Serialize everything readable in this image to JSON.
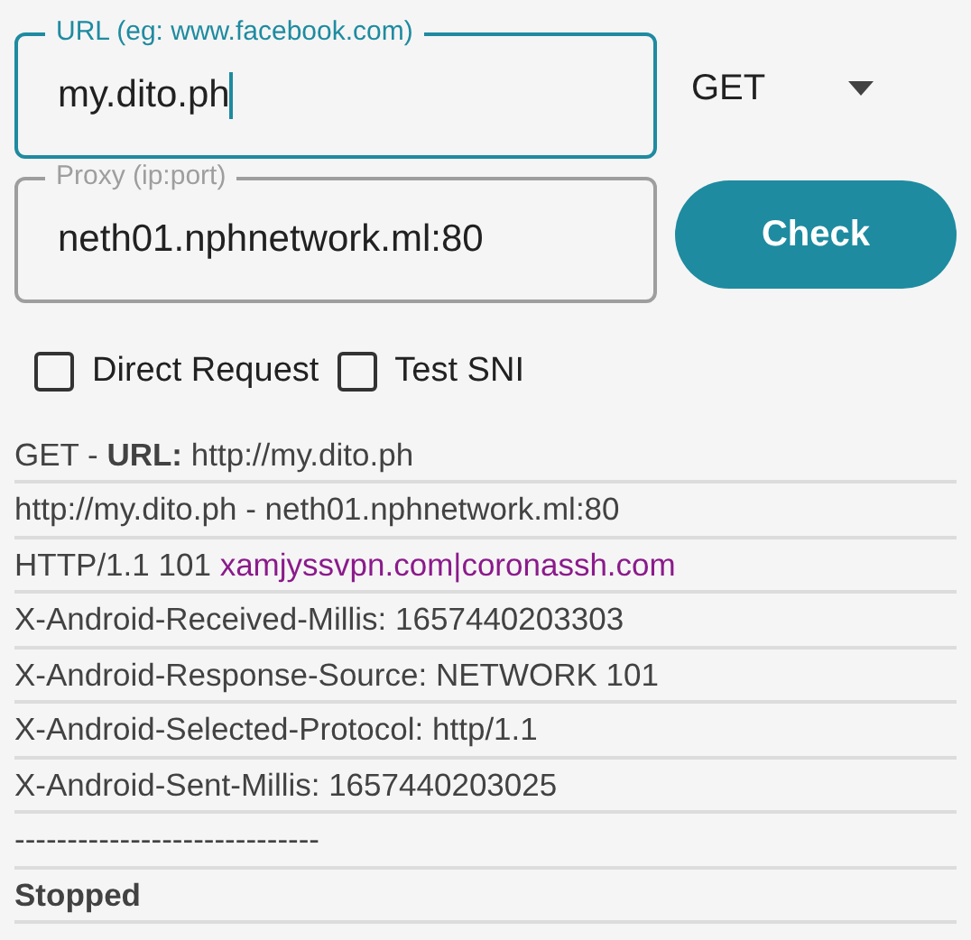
{
  "url_field": {
    "label": "URL (eg: www.facebook.com)",
    "value": "my.dito.ph",
    "focused": true
  },
  "method_dropdown": {
    "value": "GET"
  },
  "proxy_field": {
    "label": "Proxy (ip:port)",
    "value": "neth01.nphnetwork.ml:80",
    "focused": false
  },
  "check_button": {
    "label": "Check"
  },
  "options": [
    {
      "label": "Direct Request",
      "checked": false
    },
    {
      "label": "Test SNI",
      "checked": false
    }
  ],
  "log": [
    {
      "kind": "plain",
      "text": "GET - **URL:** http://my.dito.ph"
    },
    {
      "kind": "plain",
      "text": "http://my.dito.ph - neth01.nphnetwork.ml:80"
    },
    {
      "kind": "highlight",
      "text": "HTTP/1.1 101",
      "highlight": "xamjyssvpn.com|coronassh.com"
    },
    {
      "kind": "plain",
      "text": "X-Android-Received-Millis: 1657440203303"
    },
    {
      "kind": "plain",
      "text": "X-Android-Response-Source: NETWORK 101"
    },
    {
      "kind": "plain",
      "text": "X-Android-Selected-Protocol: http/1.1"
    },
    {
      "kind": "plain",
      "text": "X-Android-Sent-Millis: 1657440203025"
    },
    {
      "kind": "plain",
      "text": "-----------------------------"
    },
    {
      "kind": "status",
      "text": "Stopped"
    }
  ]
}
